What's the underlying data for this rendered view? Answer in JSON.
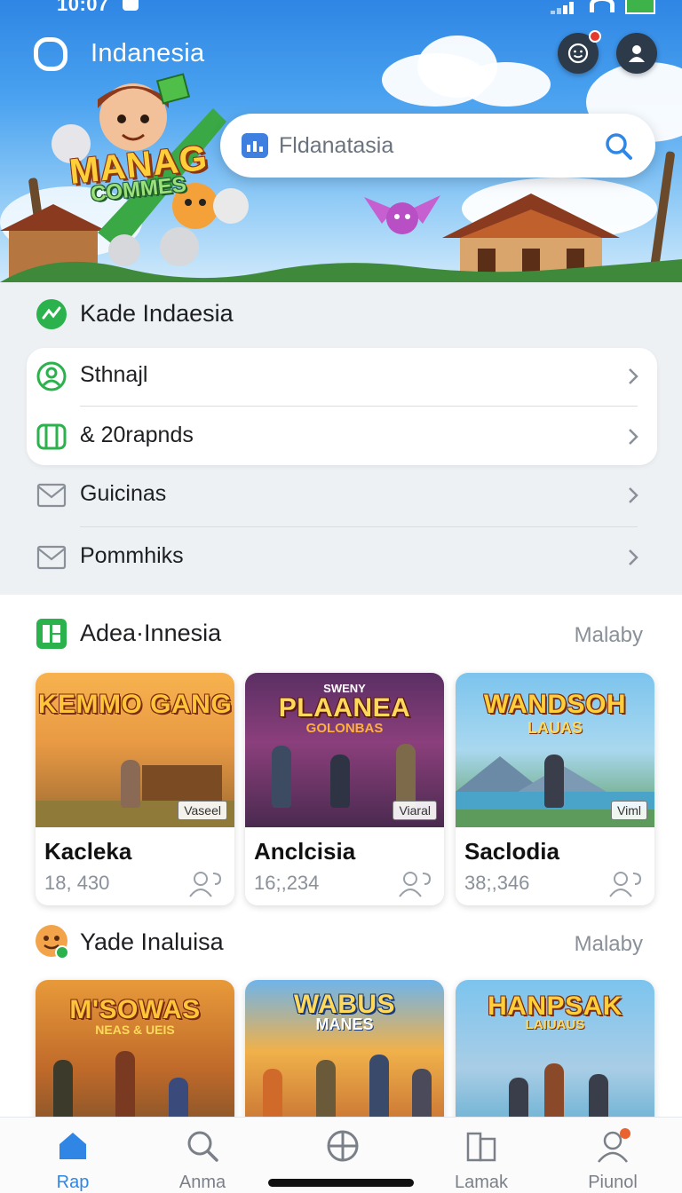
{
  "status_bar": {
    "time": "10:07"
  },
  "header": {
    "app_title": "Indanesia",
    "search": {
      "placeholder": "Fldanatasia"
    },
    "hero_logo_line1": "MANAG",
    "hero_logo_line2": "COMMES",
    "notification_badge": "1"
  },
  "section1": {
    "title": "Kade Indaesia",
    "items": [
      {
        "label": "Sthnajl",
        "icon": "user-circle-icon"
      },
      {
        "label": "& 20rapnds",
        "icon": "card-icon"
      },
      {
        "label": "Guicinas",
        "icon": "mail-icon"
      },
      {
        "label": "Pommhiks",
        "icon": "mail-icon"
      }
    ]
  },
  "section2": {
    "title": "Adea·Innesia",
    "see_more": "Malaby",
    "cards": [
      {
        "logo": "KEMMO GANG",
        "tag": "Vaseel",
        "name": "Kacleka",
        "count": "18, 430"
      },
      {
        "logo": "PLAANEA",
        "sublogo": "GOLONBAS",
        "topline": "SWENY",
        "tag": "Viaral",
        "name": "Anclcisia",
        "count": "16;,234"
      },
      {
        "logo": "WANDSOH",
        "sublogo": "LAUAS",
        "tag": "Viml",
        "name": "Saclodia",
        "count": "38;,346"
      }
    ]
  },
  "section3": {
    "title": "Yade Inaluisa",
    "see_more": "Malaby",
    "cards": [
      {
        "logo": "M'SOWAS",
        "sublogo": "NEAS & UEIS"
      },
      {
        "logo": "WABUS",
        "sublogo": "MANES"
      },
      {
        "logo": "HANPSAK",
        "sublogo": "LAIUAUS"
      }
    ]
  },
  "bottom_nav": [
    {
      "label": "Rap",
      "icon": "home-icon",
      "active": true
    },
    {
      "label": "Anma",
      "icon": "search-icon",
      "active": false
    },
    {
      "label": "",
      "icon": "globe-icon",
      "active": false
    },
    {
      "label": "Lamak",
      "icon": "library-icon",
      "active": false
    },
    {
      "label": "Piunol",
      "icon": "profile-icon",
      "active": false
    }
  ],
  "colors": {
    "accent": "#2f86e4",
    "section_icon_green": "#2bb24c",
    "notification_red": "#e53b2f"
  }
}
